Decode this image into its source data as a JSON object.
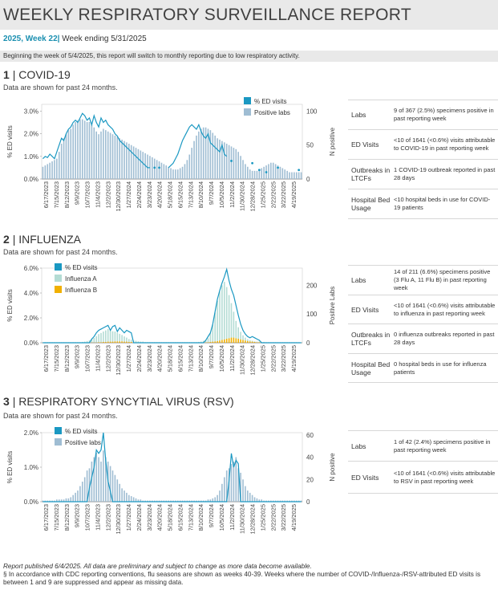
{
  "header": {
    "title": "WEEKLY RESPIRATORY SURVEILLANCE REPORT",
    "week_label": "2025, Week 22",
    "week_sep": "|",
    "week_ending": "Week ending 5/31/2025",
    "banner": "Beginning the week of 5/4/2025, this report will switch to monthly reporting due to low respiratory activity."
  },
  "sections": {
    "covid": {
      "num": "1",
      "name": "| COVID-19",
      "subtitle": "Data are shown for past 24 months.",
      "table": [
        {
          "k": "Labs",
          "v": "9 of 367 (2.5%) specimens positive in past reporting week"
        },
        {
          "k": "ED Visits",
          "v": "<10 of 1641 (<0.6%) visits attributable to COVID-19 in past reporting week"
        },
        {
          "k": "Outbreaks in LTCFs",
          "v": "1 COVID-19 outbreak reported in past 28 days"
        },
        {
          "k": "Hospital Bed Usage",
          "v": "<10 hospital beds in use for COVID-19 patients"
        }
      ]
    },
    "flu": {
      "num": "2",
      "name": "| INFLUENZA",
      "subtitle": "Data are shown for past 24 months.",
      "table": [
        {
          "k": "Labs",
          "v": "14 of 211 (6.6%) specimens positive (3 Flu A, 11 Flu B) in past reporting week"
        },
        {
          "k": "ED Visits",
          "v": "<10 of 1641 (<0.6%) visits attributable to influenza in past reporting week"
        },
        {
          "k": "Outbreaks in LTCFs",
          "v": "0 influenza outbreaks reported in past 28 days"
        },
        {
          "k": "Hospital Bed Usage",
          "v": "0 hospital beds in use for influenza patients"
        }
      ]
    },
    "rsv": {
      "num": "3",
      "name": "| RESPIRATORY SYNCYTIAL VIRUS (RSV)",
      "subtitle": "Data are shown for past 24 months.",
      "table": [
        {
          "k": "Labs",
          "v": "1 of 42 (2.4%) specimens positive in past reporting week"
        },
        {
          "k": "ED Visits",
          "v": "<10 of 1641 (<0.6%) visits attributable to RSV in past reporting week"
        }
      ]
    }
  },
  "footer": {
    "line1": "Report published 6/4/2025. All data are preliminary and subject to change as more data become available.",
    "line2": "§ In accordance with CDC reporting conventions, flu seasons are shown as weeks 40-39. Weeks where the number of COVID-/Influenza-/RSV-attributed ED visits is between 1 and 9 are suppressed and appear as missing data."
  },
  "colors": {
    "ed_line": "#1a98c2",
    "labs_bar": "#9fbdd3",
    "flu_a_bar": "#b4dcd4",
    "flu_b_bar": "#f1b000",
    "axis": "#555555"
  },
  "chart_data": [
    {
      "type": "bar",
      "id": "covid",
      "date_ticks": [
        "6/17/2023",
        "7/15/2023",
        "8/12/2023",
        "9/9/2023",
        "10/7/2023",
        "11/4/2023",
        "12/2/2023",
        "12/30/2023",
        "1/27/2024",
        "2/24/2024",
        "3/23/2024",
        "4/20/2024",
        "5/18/2024",
        "6/15/2024",
        "7/13/2024",
        "8/10/2024",
        "9/7/2024",
        "10/5/2024",
        "11/2/2024",
        "11/30/2024",
        "12/28/2024",
        "1/25/2025",
        "2/22/2025",
        "3/22/2025",
        "4/19/2025"
      ],
      "legend": [
        "% ED visits",
        "Positive labs"
      ],
      "ylabel_left": "% ED visits",
      "ylabel_right": "N positive",
      "yticks_left": [
        "0.0%",
        "1.0%",
        "2.0%",
        "3.0%"
      ],
      "yticks_right": [
        "0",
        "50",
        "100"
      ],
      "ylim_left": [
        0,
        3.3
      ],
      "ylim_right": [
        0,
        110
      ],
      "series": [
        {
          "name": "Positive labs",
          "axis": "right",
          "values": [
            18,
            20,
            22,
            24,
            26,
            28,
            30,
            40,
            52,
            60,
            66,
            72,
            74,
            80,
            84,
            86,
            88,
            88,
            86,
            84,
            84,
            80,
            76,
            70,
            66,
            70,
            74,
            72,
            70,
            68,
            66,
            64,
            62,
            60,
            58,
            56,
            54,
            52,
            50,
            48,
            46,
            44,
            42,
            40,
            38,
            36,
            34,
            32,
            30,
            28,
            26,
            24,
            22,
            20,
            18,
            16,
            14,
            14,
            14,
            16,
            18,
            22,
            28,
            36,
            46,
            56,
            64,
            70,
            74,
            76,
            76,
            74,
            72,
            68,
            64,
            60,
            58,
            56,
            54,
            52,
            50,
            48,
            46,
            44,
            40,
            34,
            28,
            22,
            18,
            14,
            12,
            12,
            12,
            14,
            16,
            18,
            20,
            22,
            24,
            24,
            22,
            20,
            18,
            16,
            14,
            12,
            10,
            10,
            10,
            10,
            10,
            10
          ]
        },
        {
          "name": "% ED visits",
          "axis": "left",
          "values": [
            0.9,
            1.0,
            0.95,
            1.1,
            1.0,
            0.9,
            1.2,
            1.5,
            1.8,
            1.7,
            2.0,
            2.2,
            2.3,
            2.5,
            2.6,
            2.5,
            2.7,
            2.9,
            2.8,
            2.6,
            2.7,
            2.4,
            2.8,
            2.5,
            2.3,
            2.7,
            2.5,
            2.6,
            2.4,
            2.3,
            2.2,
            2.0,
            1.9,
            1.7,
            1.6,
            1.5,
            1.4,
            1.3,
            1.2,
            1.1,
            1.0,
            0.9,
            0.8,
            0.7,
            0.6,
            0.5,
            0.5,
            null,
            0.5,
            null,
            0.5,
            null,
            null,
            null,
            0.5,
            0.6,
            0.7,
            0.9,
            1.1,
            1.4,
            1.7,
            1.9,
            2.1,
            2.3,
            2.4,
            2.3,
            2.2,
            2.4,
            2.1,
            1.9,
            1.8,
            2.0,
            1.6,
            1.5,
            1.4,
            1.3,
            1.2,
            1.5,
            1.1,
            1.0,
            null,
            0.8,
            null,
            null,
            null,
            null,
            null,
            null,
            null,
            null,
            0.7,
            null,
            null,
            0.4,
            null,
            null,
            0.3,
            null,
            null,
            null,
            null,
            0.5,
            null,
            null,
            null,
            null,
            null,
            null,
            null,
            null,
            0.4,
            null
          ]
        }
      ]
    },
    {
      "type": "bar",
      "id": "flu",
      "date_ticks": [
        "6/17/2023",
        "7/15/2023",
        "8/12/2023",
        "9/9/2023",
        "10/7/2023",
        "11/4/2023",
        "12/2/2023",
        "12/30/2023",
        "1/27/2024",
        "2/24/2024",
        "3/23/2024",
        "4/20/2024",
        "5/18/2024",
        "6/15/2024",
        "7/13/2024",
        "8/10/2024",
        "9/7/2024",
        "10/5/2024",
        "11/2/2024",
        "11/30/2024",
        "12/28/2024",
        "1/25/2025",
        "2/22/2025",
        "3/22/2025",
        "4/19/2025"
      ],
      "legend": [
        "% ED visits",
        "Influenza A",
        "Influenza B"
      ],
      "ylabel_left": "% ED visits",
      "ylabel_right": "Positive Labs",
      "yticks_left": [
        "0.0%",
        "2.0%",
        "4.0%",
        "6.0%"
      ],
      "yticks_right": [
        "0",
        "100",
        "200"
      ],
      "ylim_left": [
        0,
        6.0
      ],
      "ylim_right": [
        0,
        260
      ],
      "series": [
        {
          "name": "Influenza A",
          "axis": "right",
          "values": [
            2,
            2,
            2,
            2,
            2,
            2,
            2,
            2,
            2,
            2,
            2,
            2,
            2,
            2,
            2,
            2,
            2,
            3,
            4,
            6,
            8,
            12,
            16,
            22,
            28,
            32,
            36,
            40,
            44,
            40,
            36,
            34,
            30,
            26,
            22,
            18,
            14,
            10,
            8,
            6,
            5,
            4,
            3,
            3,
            2,
            2,
            2,
            2,
            2,
            2,
            2,
            2,
            2,
            2,
            2,
            2,
            2,
            2,
            2,
            2,
            2,
            2,
            2,
            2,
            2,
            2,
            2,
            3,
            4,
            6,
            8,
            14,
            30,
            60,
            100,
            140,
            170,
            190,
            200,
            180,
            150,
            120,
            90,
            60,
            40,
            26,
            16,
            10,
            6,
            4,
            3,
            2,
            2,
            2,
            2,
            2,
            2,
            2,
            2,
            2,
            2,
            2,
            2,
            2,
            2,
            2,
            2,
            2,
            2,
            2,
            2,
            2
          ]
        },
        {
          "name": "Influenza B",
          "axis": "right",
          "values": [
            0,
            0,
            0,
            0,
            0,
            0,
            0,
            0,
            0,
            0,
            0,
            0,
            0,
            0,
            0,
            0,
            0,
            0,
            0,
            0,
            0,
            1,
            1,
            1,
            2,
            2,
            3,
            3,
            4,
            4,
            4,
            5,
            5,
            5,
            5,
            4,
            4,
            3,
            3,
            2,
            2,
            1,
            1,
            1,
            0,
            0,
            0,
            0,
            0,
            0,
            0,
            0,
            0,
            0,
            0,
            0,
            0,
            0,
            0,
            0,
            0,
            0,
            0,
            0,
            0,
            0,
            0,
            0,
            0,
            1,
            1,
            2,
            3,
            4,
            5,
            6,
            8,
            10,
            12,
            14,
            16,
            18,
            18,
            16,
            14,
            12,
            10,
            8,
            6,
            5,
            4,
            3,
            2,
            2,
            1,
            1,
            0,
            0,
            0,
            0,
            0,
            0,
            0,
            0,
            0,
            0,
            0,
            0,
            0,
            0,
            0,
            0
          ]
        },
        {
          "name": "% ED visits",
          "axis": "left",
          "values": [
            0,
            0,
            0,
            0,
            0,
            0,
            0,
            0,
            0,
            0,
            0,
            0,
            0,
            0,
            0,
            0,
            0,
            0,
            0,
            0,
            0,
            0.3,
            0.5,
            0.8,
            1.0,
            1.1,
            1.2,
            1.3,
            1.4,
            1.0,
            1.3,
            1.4,
            0.9,
            1.2,
            1.0,
            0.8,
            1.0,
            0.9,
            0.8,
            0,
            0,
            0,
            0,
            0,
            0,
            0,
            0,
            0,
            0,
            0,
            0,
            0,
            0,
            0,
            0,
            0,
            0,
            0,
            0,
            0,
            0,
            0,
            0,
            0,
            0,
            0,
            0,
            0,
            0,
            0,
            0.2,
            0.5,
            0.8,
            1.5,
            2.5,
            3.5,
            4.2,
            4.8,
            5.3,
            5.9,
            5.0,
            4.3,
            3.8,
            3.0,
            2.2,
            1.5,
            1.0,
            0.7,
            0.5,
            0.4,
            0.5,
            0.4,
            0.3,
            0.2,
            0,
            0,
            0,
            0,
            0,
            0,
            0,
            0,
            0,
            0,
            0,
            0,
            0,
            0,
            0,
            0,
            0,
            0
          ]
        }
      ]
    },
    {
      "type": "bar",
      "id": "rsv",
      "date_ticks": [
        "6/17/2023",
        "7/15/2023",
        "8/12/2023",
        "9/9/2023",
        "10/7/2023",
        "11/4/2023",
        "12/2/2023",
        "12/30/2023",
        "1/27/2024",
        "2/24/2024",
        "3/23/2024",
        "4/20/2024",
        "5/18/2024",
        "6/15/2024",
        "7/13/2024",
        "8/10/2024",
        "9/7/2024",
        "10/5/2024",
        "11/2/2024",
        "11/30/2024",
        "12/28/2024",
        "1/25/2025",
        "2/22/2025",
        "3/22/2025",
        "4/19/2025"
      ],
      "legend": [
        "% ED visits",
        "Positive labs"
      ],
      "ylabel_left": "% ED visits",
      "ylabel_right": "N positive",
      "yticks_left": [
        "0.0%",
        "1.0%",
        "2.0%"
      ],
      "yticks_right": [
        "0",
        "20",
        "40",
        "60"
      ],
      "ylim_left": [
        0,
        2.0
      ],
      "ylim_right": [
        0,
        62
      ],
      "series": [
        {
          "name": "Positive labs",
          "axis": "right",
          "values": [
            1,
            1,
            1,
            1,
            1,
            1,
            2,
            2,
            2,
            2,
            3,
            3,
            4,
            6,
            8,
            10,
            14,
            18,
            22,
            28,
            30,
            36,
            40,
            44,
            40,
            36,
            46,
            40,
            36,
            32,
            28,
            24,
            20,
            16,
            12,
            10,
            8,
            6,
            5,
            4,
            3,
            2,
            2,
            1,
            1,
            1,
            1,
            1,
            1,
            1,
            1,
            1,
            1,
            1,
            1,
            1,
            1,
            1,
            1,
            1,
            1,
            1,
            1,
            1,
            1,
            1,
            1,
            1,
            1,
            1,
            1,
            2,
            2,
            3,
            4,
            6,
            10,
            16,
            22,
            28,
            30,
            34,
            36,
            40,
            30,
            26,
            20,
            14,
            10,
            8,
            6,
            4,
            3,
            2,
            2,
            1,
            1,
            1,
            1,
            1,
            1,
            1,
            1,
            1,
            1,
            1,
            1,
            1,
            1,
            1,
            1,
            1
          ]
        },
        {
          "name": "% ED visits",
          "axis": "left",
          "values": [
            0,
            0,
            0,
            0,
            0,
            0,
            0,
            0,
            0,
            0,
            0,
            0,
            0,
            0,
            0,
            0,
            0,
            0,
            0,
            0,
            0.4,
            0.7,
            1.0,
            1.5,
            1.4,
            1.5,
            2.0,
            1.2,
            0.6,
            0.3,
            0,
            0,
            0,
            0,
            0,
            0,
            0,
            0,
            0,
            0,
            0,
            0,
            0,
            0,
            0,
            0,
            0,
            0,
            0,
            0,
            0,
            0,
            0,
            0,
            0,
            0,
            0,
            0,
            0,
            0,
            0,
            0,
            0,
            0,
            0,
            0,
            0,
            0,
            0,
            0,
            0,
            0,
            0,
            0,
            0,
            0,
            0,
            0,
            0,
            0,
            0.6,
            1.4,
            1.0,
            1.2,
            1.1,
            0,
            0,
            0,
            0,
            0,
            0,
            0,
            0,
            0,
            0,
            0,
            0,
            0,
            0,
            0,
            0,
            0,
            0,
            0,
            0,
            0,
            0,
            0,
            0,
            0,
            0,
            0
          ]
        }
      ]
    }
  ]
}
